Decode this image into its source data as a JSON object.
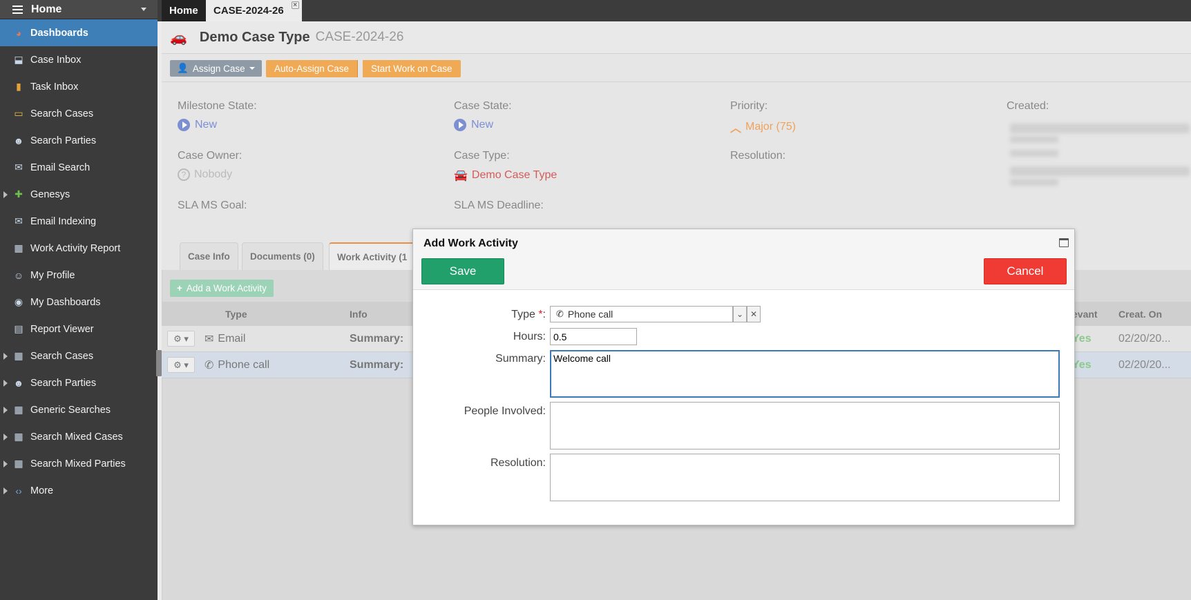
{
  "sidebar": {
    "header": "Home",
    "items": [
      {
        "label": "Dashboards",
        "icon": "chart-pie-icon",
        "active": true
      },
      {
        "label": "Case Inbox",
        "icon": "inbox-icon"
      },
      {
        "label": "Task Inbox",
        "icon": "clipboard-icon"
      },
      {
        "label": "Search Cases",
        "icon": "folder-search-icon"
      },
      {
        "label": "Search Parties",
        "icon": "user-search-icon"
      },
      {
        "label": "Email Search",
        "icon": "envelope-icon"
      },
      {
        "label": "Genesys",
        "icon": "puzzle-icon",
        "expandable": true
      },
      {
        "label": "Email Indexing",
        "icon": "mail-index-icon"
      },
      {
        "label": "Work Activity Report",
        "icon": "report-icon"
      },
      {
        "label": "My Profile",
        "icon": "profile-icon"
      },
      {
        "label": "My Dashboards",
        "icon": "dashboard-icon"
      },
      {
        "label": "Report Viewer",
        "icon": "book-icon"
      },
      {
        "label": "Search Cases",
        "icon": "table-icon",
        "expandable": true
      },
      {
        "label": "Search Parties",
        "icon": "user-search-icon",
        "expandable": true
      },
      {
        "label": "Generic Searches",
        "icon": "search-table-icon",
        "expandable": true
      },
      {
        "label": "Search Mixed Cases",
        "icon": "table-icon",
        "expandable": true
      },
      {
        "label": "Search Mixed Parties",
        "icon": "table-icon",
        "expandable": true
      },
      {
        "label": "More",
        "icon": "code-icon",
        "expandable": true
      }
    ]
  },
  "tabs": {
    "home": "Home",
    "case": "CASE-2024-26",
    "close": "×"
  },
  "case": {
    "type": "Demo Case Type",
    "number": "CASE-2024-26",
    "assign_label": "Assign Case",
    "auto_assign_label": "Auto-Assign Case",
    "start_work_label": "Start Work on Case",
    "milestone_state_label": "Milestone State:",
    "milestone_state": "New",
    "case_state_label": "Case State:",
    "case_state": "New",
    "priority_label": "Priority:",
    "priority": "Major (75)",
    "created_label": "Created:",
    "case_owner_label": "Case Owner:",
    "case_owner": "Nobody",
    "case_type_label": "Case Type:",
    "case_type": "Demo Case Type",
    "resolution_label": "Resolution:",
    "sla_goal_label": "SLA MS Goal:",
    "sla_deadline_label": "SLA MS Deadline:"
  },
  "case_tabs": [
    {
      "label": "Case Info"
    },
    {
      "label": "Documents (0)"
    },
    {
      "label": "Work Activity (1"
    }
  ],
  "activity": {
    "add_label": "Add a Work Activity",
    "columns": {
      "type": "Type",
      "info": "Info",
      "relevant": "evant",
      "created": "Creat. On"
    },
    "rows": [
      {
        "type": "Email",
        "summary": "Summary:",
        "relevant": "Yes",
        "created": "02/20/20..."
      },
      {
        "type": "Phone call",
        "summary": "Summary:",
        "relevant": "Yes",
        "created": "02/20/20..."
      }
    ]
  },
  "modal": {
    "title": "Add Work Activity",
    "save_label": "Save",
    "cancel_label": "Cancel",
    "type_label": "Type",
    "type_required": "*",
    "type_colon": ":",
    "type_value": "Phone call",
    "hours_label": "Hours:",
    "hours_value": "0.5",
    "summary_label": "Summary:",
    "summary_value": "Welcome call",
    "people_label": "People Involved:",
    "people_value": "",
    "resolution_label": "Resolution:",
    "resolution_value": ""
  },
  "colors": {
    "sidebar_bg": "#3b3b3b",
    "active_item": "#3d7fb6",
    "orange_button": "#f0a955",
    "save_green": "#22a06b",
    "cancel_red": "#ef3b34",
    "priority_orange": "#f0a25a",
    "case_type_red": "#d55a5a",
    "state_blue": "#7b8fd1"
  }
}
